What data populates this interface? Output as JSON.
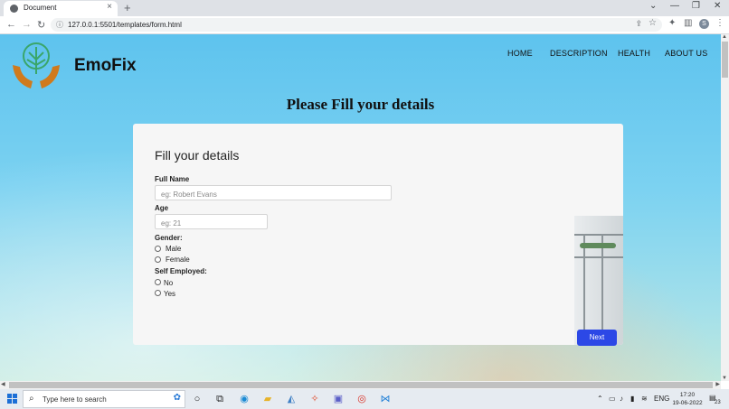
{
  "browser": {
    "tab_title": "Document",
    "tab_close": "×",
    "new_tab": "+",
    "url": "127.0.0.1:5501/templates/form.html",
    "profile_initial": "S",
    "window_controls": {
      "dropdown": "⌄",
      "minimize": "—",
      "restore": "❐",
      "close": "✕"
    },
    "nav": {
      "back": "←",
      "forward": "→",
      "reload": "↻"
    }
  },
  "site": {
    "brand": "EmoFix",
    "nav_items": [
      "HOME",
      "DESCRIPTION",
      "HEALTH",
      "ABOUT US"
    ]
  },
  "form": {
    "page_heading": "Please Fill your details",
    "card_title": "Fill your details",
    "full_name_label": "Full Name",
    "full_name_placeholder": "eg: Robert Evans",
    "age_label": "Age",
    "age_placeholder": "eg: 21",
    "gender_label": "Gender:",
    "gender_options": [
      "Male",
      "Female"
    ],
    "self_employed_label": "Self Employed:",
    "self_employed_options": [
      "No",
      "Yes"
    ],
    "next_label": "Next"
  },
  "taskbar": {
    "search_placeholder": "Type here to search",
    "language": "ENG",
    "time": "17:20",
    "date": "19-06-2022",
    "notification_count": "23"
  },
  "colors": {
    "accent_button": "#2c48e6",
    "page_sky": "#5ec3ee",
    "logo_tree": "#3aa66a",
    "logo_hands": "#d07a1c"
  }
}
